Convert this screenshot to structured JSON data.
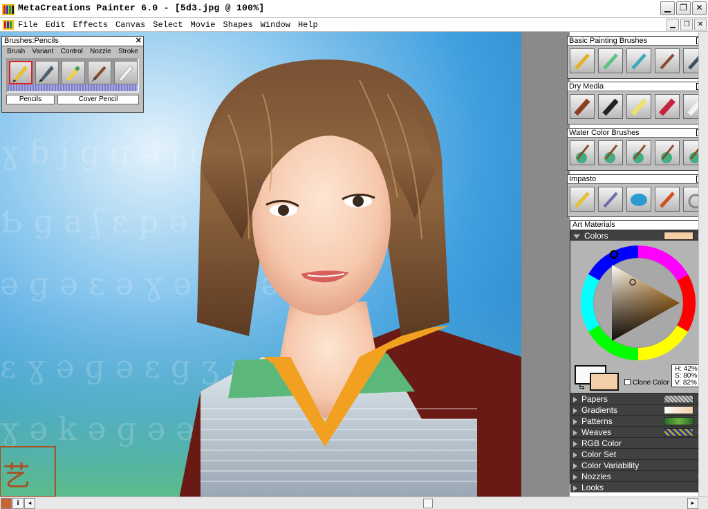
{
  "window": {
    "title": "MetaCreations Painter 6.0 - [5d3.jpg @ 100%]",
    "minimize": "▁",
    "restore": "❐",
    "close": "✕"
  },
  "menubar": {
    "items": [
      "File",
      "Edit",
      "Effects",
      "Canvas",
      "Select",
      "Movie",
      "Shapes",
      "Window",
      "Help"
    ],
    "doc_minimize": "▁",
    "doc_restore": "❐",
    "doc_close": "✕"
  },
  "brushes_palette": {
    "title": "Brushes:Pencils",
    "close": "✕",
    "tabs": [
      "Brush",
      "Variant",
      "Control",
      "Nozzle",
      "Stroke"
    ],
    "category": "Pencils",
    "variant": "Cover Pencil"
  },
  "right_palettes": [
    {
      "title": "Basic Painting Brushes",
      "icons": [
        "pencil-icon",
        "airbrush-icon",
        "chalk-icon",
        "brush-icon",
        "pen-icon"
      ]
    },
    {
      "title": "Dry Media",
      "icons": [
        "conte-icon",
        "charcoal-icon",
        "pastel-icon",
        "crayon-icon",
        "chalk-stick-icon"
      ]
    },
    {
      "title": "Water Color Brushes",
      "icons": [
        "wc-brush-1-icon",
        "wc-brush-2-icon",
        "wc-brush-3-icon",
        "wc-brush-4-icon",
        "wc-brush-5-icon"
      ]
    },
    {
      "title": "Impasto",
      "icons": [
        "impasto-brush-icon",
        "palette-knife-icon",
        "impasto-paint-icon",
        "impasto-drip-icon",
        "impasto-swirl-icon"
      ]
    }
  ],
  "art_materials": {
    "title": "Art Materials",
    "colors_label": "Colors",
    "hsv": {
      "h": "H: 42%",
      "s": "S: 80%",
      "v": "V: 82%"
    },
    "clone_color": "Clone Color",
    "sections": [
      "Papers",
      "Gradients",
      "Patterns",
      "Weaves",
      "RGB Color",
      "Color Set",
      "Color Variability",
      "Nozzles",
      "Looks"
    ]
  },
  "colors": {
    "current_color": "#f4d0a8",
    "secondary_color": "#fafafa",
    "hue_accent": "#f09a2a"
  },
  "status": {
    "info_icon": "i",
    "scroll_left": "◂",
    "scroll_right": "▸"
  }
}
